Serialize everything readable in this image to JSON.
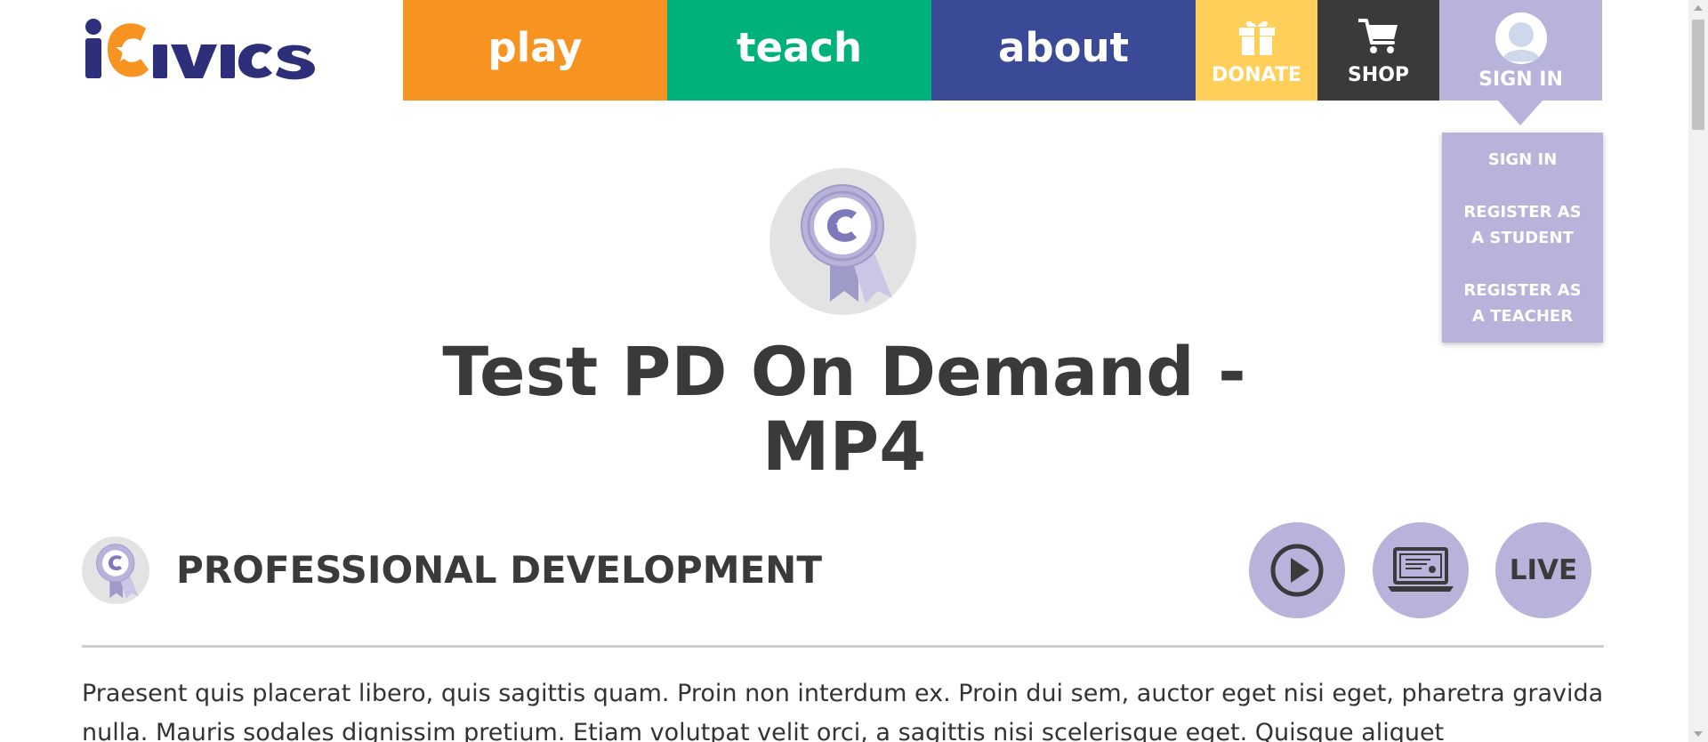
{
  "header": {
    "logo_text": "iCivics",
    "nav": {
      "play": "play",
      "teach": "teach",
      "about": "about",
      "donate": "DONATE",
      "shop": "SHOP",
      "signin": "SIGN IN"
    },
    "icons": {
      "donate": "gift-icon",
      "shop": "cart-icon",
      "signin": "user-avatar-icon"
    }
  },
  "dropdown": {
    "items": [
      {
        "label": "SIGN IN"
      },
      {
        "label": "REGISTER AS A STUDENT"
      },
      {
        "label": "REGISTER AS A TEACHER"
      }
    ]
  },
  "page": {
    "title": "Test PD On Demand - MP4",
    "section_title": "PROFESSIONAL DEVELOPMENT",
    "format_buttons": {
      "video_icon": "play-circle-icon",
      "online_icon": "laptop-certificate-icon",
      "live_label": "LIVE"
    },
    "body_text": "Praesent quis placerat libero, quis sagittis quam. Proin non interdum ex. Proin dui sem, auctor eget nisi eget, pharetra gravida nulla. Mauris sodales dignissim pretium. Etiam volutpat velit orci, a sagittis nisi scelerisque eget. Quisque aliquet"
  },
  "colors": {
    "play": "#f79321",
    "teach": "#00b27a",
    "about": "#3a4a96",
    "donate": "#ffcf5a",
    "shop": "#3a3a3a",
    "signin": "#b7b3db",
    "logo_navy": "#2e2f7a",
    "logo_orange": "#f79321"
  }
}
